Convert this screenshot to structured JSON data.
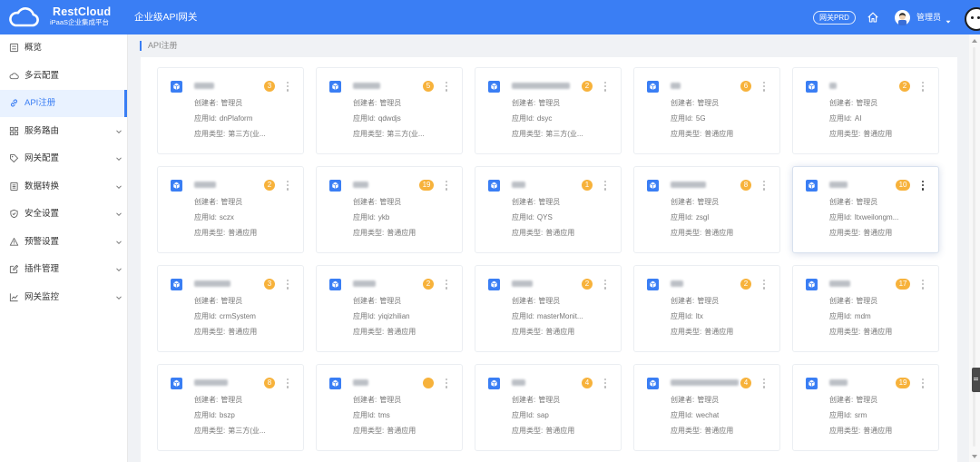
{
  "colors": {
    "accent": "#3a7ef4",
    "badge": "#f7b23b",
    "active_bg": "#e9f2ff",
    "page_bg": "#f0f2f5"
  },
  "header": {
    "brand_name": "RestCloud",
    "brand_tagline": "iPaaS企业集成平台",
    "product_title": "企业级API网关",
    "env_badge": "网关PRD",
    "user_name": "管理员",
    "icons": {
      "logo": "cloud-logo-icon",
      "home": "home-icon",
      "avatar": "user-avatar",
      "caret": "caret-down-icon"
    }
  },
  "sidebar": {
    "items": [
      {
        "label": "概览",
        "icon": "overview-icon",
        "expandable": false,
        "active": false
      },
      {
        "label": "多云配置",
        "icon": "cloud-icon",
        "expandable": false,
        "active": false
      },
      {
        "label": "API注册",
        "icon": "link-icon",
        "expandable": false,
        "active": true
      },
      {
        "label": "服务路由",
        "icon": "grid-icon",
        "expandable": true,
        "active": false
      },
      {
        "label": "网关配置",
        "icon": "tag-icon",
        "expandable": true,
        "active": false
      },
      {
        "label": "数据转换",
        "icon": "document-icon",
        "expandable": true,
        "active": false
      },
      {
        "label": "安全设置",
        "icon": "shield-icon",
        "expandable": true,
        "active": false
      },
      {
        "label": "预警设置",
        "icon": "warning-icon",
        "expandable": true,
        "active": false
      },
      {
        "label": "插件管理",
        "icon": "edit-icon",
        "expandable": true,
        "active": false
      },
      {
        "label": "网关监控",
        "icon": "line-chart-icon",
        "expandable": true,
        "active": false
      }
    ]
  },
  "breadcrumb": {
    "current": "API注册"
  },
  "card_labels": {
    "creator": "创建者:",
    "app_id": "应用Id:",
    "app_type": "应用类型:"
  },
  "apps": [
    {
      "badge": "3",
      "creator": "管理员",
      "app_id": "dnPlaform",
      "app_type": "第三方(业..."
    },
    {
      "badge": "5",
      "creator": "管理员",
      "app_id": "qdwdjs",
      "app_type": "第三方(业..."
    },
    {
      "badge": "2",
      "creator": "管理员",
      "app_id": "dsyc",
      "app_type": "第三方(业..."
    },
    {
      "badge": "6",
      "creator": "管理员",
      "app_id": "5G",
      "app_type": "普通应用"
    },
    {
      "badge": "2",
      "creator": "管理员",
      "app_id": "AI",
      "app_type": "普通应用"
    },
    {
      "badge": "2",
      "creator": "管理员",
      "app_id": "sczx",
      "app_type": "普通应用"
    },
    {
      "badge": "19",
      "creator": "管理员",
      "app_id": "ykb",
      "app_type": "普通应用"
    },
    {
      "badge": "1",
      "creator": "管理员",
      "app_id": "QYS",
      "app_type": "普通应用"
    },
    {
      "badge": "8",
      "creator": "管理员",
      "app_id": "zsgl",
      "app_type": "普通应用"
    },
    {
      "badge": "10",
      "creator": "管理员",
      "app_id": "ltxweilongm...",
      "app_type": "普通应用",
      "hovered": true
    },
    {
      "badge": "3",
      "creator": "管理员",
      "app_id": "crmSystem",
      "app_type": "普通应用"
    },
    {
      "badge": "2",
      "creator": "管理员",
      "app_id": "yiqizhilian",
      "app_type": "普通应用"
    },
    {
      "badge": "2",
      "creator": "管理员",
      "app_id": "masterMonit...",
      "app_type": "普通应用"
    },
    {
      "badge": "2",
      "creator": "管理员",
      "app_id": "ltx",
      "app_type": "普通应用"
    },
    {
      "badge": "17",
      "creator": "管理员",
      "app_id": "mdm",
      "app_type": "普通应用"
    },
    {
      "badge": "8",
      "creator": "管理员",
      "app_id": "bszp",
      "app_type": "第三方(业..."
    },
    {
      "badge": "",
      "creator": "管理员",
      "app_id": "tms",
      "app_type": "普通应用"
    },
    {
      "badge": "4",
      "creator": "管理员",
      "app_id": "sap",
      "app_type": "普通应用"
    },
    {
      "badge": "4",
      "creator": "管理员",
      "app_id": "wechat",
      "app_type": "普通应用"
    },
    {
      "badge": "19",
      "creator": "管理员",
      "app_id": "srm",
      "app_type": "普通应用"
    }
  ]
}
